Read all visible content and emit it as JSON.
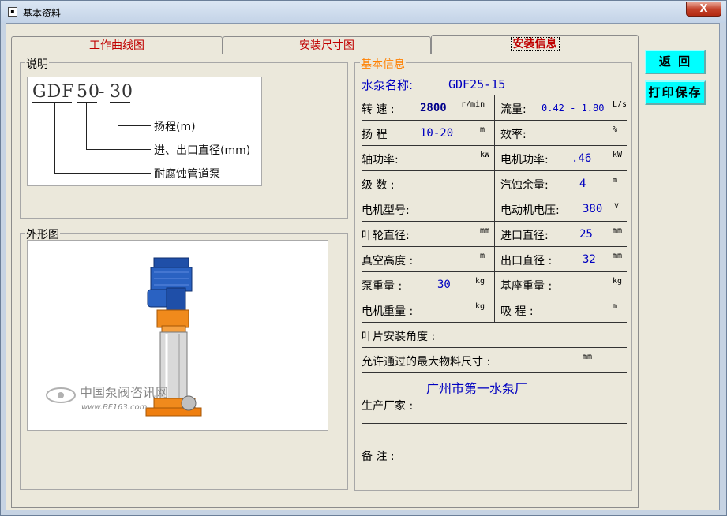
{
  "window": {
    "title": "基本资料",
    "close_label": "X"
  },
  "tabs": [
    {
      "label": "工作曲线图",
      "active": false
    },
    {
      "label": "安装尺寸图",
      "active": false
    },
    {
      "label": "安装信息",
      "active": true
    }
  ],
  "explanation": {
    "legend": "说明",
    "code_part1": "GDF",
    "code_part2": "50",
    "code_dash1": "-",
    "code_part3": "30",
    "labels": [
      "扬程(m)",
      "进、出口直径(mm)",
      "耐腐蚀管道泵"
    ]
  },
  "appearance": {
    "legend": "外形图",
    "watermark_cn": "中国泵阀咨讯网",
    "watermark_url": "www.BF163.com"
  },
  "info": {
    "legend": "基本信息",
    "pump_name_label": "水泵名称:",
    "pump_name_value": "GDF25-15",
    "rows": {
      "speed": {
        "label": "转 速 :",
        "value": "2800",
        "unit": "r/min"
      },
      "flow": {
        "label": "流量:",
        "value": "0.42 - 1.80",
        "unit": "L/s"
      },
      "head": {
        "label": "扬 程",
        "value": "10-20",
        "unit": "m"
      },
      "efficiency": {
        "label": "效率:",
        "value": "",
        "unit": "%"
      },
      "shaft_power": {
        "label": "轴功率:",
        "value": "",
        "unit": "kW"
      },
      "motor_power": {
        "label": "电机功率:",
        "value": ".46",
        "unit": "kW"
      },
      "stages": {
        "label": "级 数 :",
        "value": "",
        "unit": ""
      },
      "npsh": {
        "label": "汽蚀余量:",
        "value": "4",
        "unit": "m"
      },
      "motor_model": {
        "label": "电机型号:",
        "value": "",
        "unit": ""
      },
      "motor_voltage": {
        "label": "电动机电压:",
        "value": "380",
        "unit": "v"
      },
      "impeller_dia": {
        "label": "叶轮直径:",
        "value": "",
        "unit": "mm"
      },
      "inlet_dia": {
        "label": "进口直径:",
        "value": "25",
        "unit": "mm"
      },
      "vacuum_height": {
        "label": "真空高度 :",
        "value": "",
        "unit": "m"
      },
      "outlet_dia": {
        "label": "出口直径 :",
        "value": "32",
        "unit": "mm"
      },
      "pump_weight": {
        "label": "泵重量 :",
        "value": "30",
        "unit": "kg"
      },
      "base_weight": {
        "label": "基座重量 :",
        "value": "",
        "unit": "kg"
      },
      "motor_weight": {
        "label": "电机重量 :",
        "value": "",
        "unit": "kg"
      },
      "suction_head": {
        "label": "吸 程 :",
        "value": "",
        "unit": "m"
      }
    },
    "blade_angle_label": "叶片安装角度 :",
    "max_particle_label": "允许通过的最大物料尺寸 :",
    "max_particle_unit": "mm",
    "manufacturer_value": "广州市第一水泵厂",
    "manufacturer_label": "生产厂家 :",
    "remarks_label": "备 注 :"
  },
  "buttons": {
    "back": "返 回",
    "print_save": "打印保存"
  },
  "colors": {
    "tab_text": "#c00000",
    "value_text": "#0000c0",
    "button_bg": "#00ffff",
    "legend_info": "#ff8000"
  }
}
